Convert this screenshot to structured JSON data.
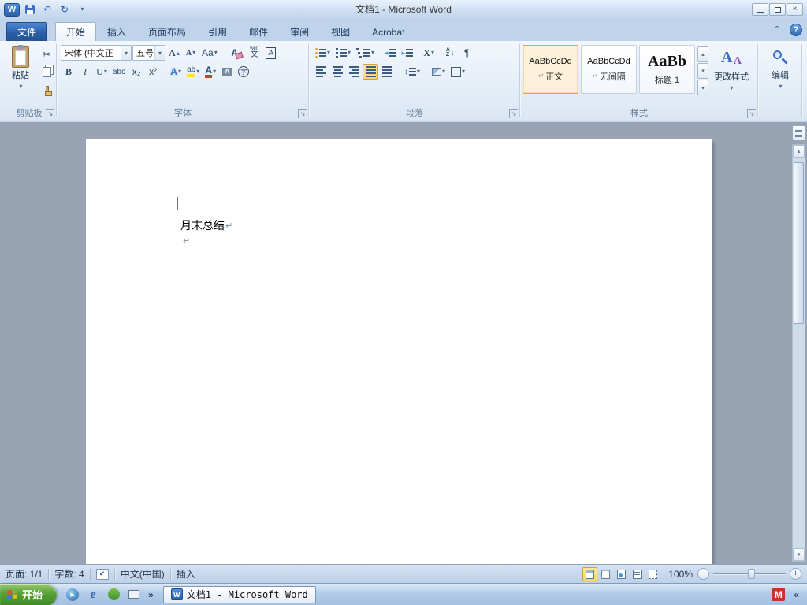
{
  "window": {
    "title": "文档1 - Microsoft Word"
  },
  "ribbon": {
    "file_tab": "文件",
    "tabs": [
      {
        "label": "开始",
        "active": true
      },
      {
        "label": "插入"
      },
      {
        "label": "页面布局"
      },
      {
        "label": "引用"
      },
      {
        "label": "邮件"
      },
      {
        "label": "审阅"
      },
      {
        "label": "视图"
      },
      {
        "label": "Acrobat"
      }
    ],
    "clipboard": {
      "label": "剪贴板",
      "paste": "粘贴"
    },
    "font": {
      "label": "字体",
      "name": "宋体 (中文正",
      "size": "五号",
      "grow": "A",
      "shrink": "A",
      "change_case": "Aa",
      "clear": "A",
      "phonetic_top": "wén",
      "phonetic_bottom": "文",
      "char_border": "A",
      "bold": "B",
      "italic": "I",
      "underline": "U",
      "strike": "abc",
      "subscript": "x₂",
      "superscript": "x²",
      "effects": "A",
      "highlight": "ab",
      "color": "A",
      "char_shading": "A",
      "enclose": "字"
    },
    "paragraph": {
      "label": "段落",
      "pilcrow": "¶",
      "asian": "X",
      "sort_a": "A",
      "sort_z": "Z"
    },
    "styles": {
      "label": "样式",
      "items": [
        {
          "preview": "AaBbCcDd",
          "marker": "↵",
          "name": "正文",
          "selected": true
        },
        {
          "preview": "AaBbCcDd",
          "marker": "↵",
          "name": "无间隔"
        },
        {
          "preview": "AaBb",
          "marker": "",
          "name": "标题 1"
        }
      ],
      "change_styles": "更改样式"
    },
    "editing": {
      "label": "编辑"
    }
  },
  "document": {
    "heading": "月末总结",
    "mark": "↵"
  },
  "status": {
    "page": "页面: 1/1",
    "words": "字数: 4",
    "language": "中文(中国)",
    "mode": "插入",
    "zoom": "100%"
  },
  "taskbar": {
    "start": "开始",
    "window": "文档1 - Microsoft Word",
    "tray_m": "M"
  },
  "icons": {
    "word_logo": "W",
    "undo": "↶",
    "redo": "↻",
    "dropdown": "▾",
    "up": "▴",
    "down": "▾",
    "close": "×",
    "help": "?",
    "collapse": "ˆ",
    "launcher": "↘",
    "cut": "✂",
    "check": "✔",
    "chevron_right": "»",
    "chevron_left": "«",
    "outdent": "◂",
    "indent": "▸",
    "updown": "↕",
    "play": "▶",
    "ie": "e",
    "minus": "−",
    "plus": "+",
    "sort_down": "↓"
  },
  "colors": {
    "accent_orange": "#e8a33d",
    "file_tab_blue": "#2b5ea7",
    "selection_yellow": "#fbd567",
    "taskbar_green": "#4f9a33"
  }
}
